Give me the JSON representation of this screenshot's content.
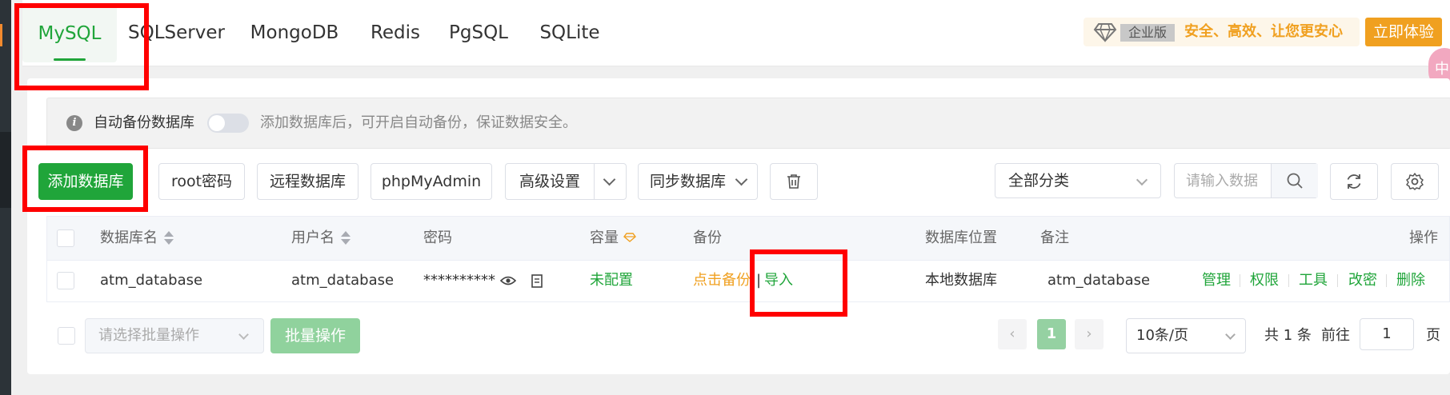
{
  "tabs": [
    {
      "label": "MySQL",
      "active": true
    },
    {
      "label": "SQLServer"
    },
    {
      "label": "MongoDB"
    },
    {
      "label": "Redis"
    },
    {
      "label": "PgSQL"
    },
    {
      "label": "SQLite"
    }
  ],
  "promo": {
    "badge": "企业版",
    "slogan": "安全、高效、让您更安心",
    "try_button": "立即体验",
    "float_char": "中"
  },
  "info": {
    "label": "自动备份数据库",
    "hint": "添加数据库后，可开启自动备份，保证数据安全。",
    "auto_backup_enabled": false
  },
  "toolbar": {
    "add_db": "添加数据库",
    "root_pwd": "root密码",
    "remote_db": "远程数据库",
    "phpmyadmin": "phpMyAdmin",
    "advanced": "高级设置",
    "sync_db": "同步数据库",
    "category": "全部分类",
    "search_placeholder": "请输入数据"
  },
  "table": {
    "headers": {
      "name": "数据库名",
      "user": "用户名",
      "password": "密码",
      "capacity": "容量",
      "backup": "备份",
      "location": "数据库位置",
      "remark": "备注",
      "ops": "操作"
    },
    "rows": [
      {
        "name": "atm_database",
        "user": "atm_database",
        "password": "**********",
        "capacity": "未配置",
        "backup": "点击备份",
        "backup_sep": "|",
        "import": "导入",
        "location": "本地数据库",
        "remark": "atm_database",
        "ops": [
          "管理",
          "权限",
          "工具",
          "改密",
          "删除"
        ]
      }
    ]
  },
  "footer": {
    "batch_placeholder": "请选择批量操作",
    "batch_button": "批量操作",
    "prev": "‹",
    "page": "1",
    "next": "›",
    "page_size": "10条/页",
    "total": "共 1 条",
    "goto": "前往",
    "goto_value": "1",
    "page_unit": "页"
  },
  "colors": {
    "accent": "#20a53a",
    "warning": "#f0a020",
    "highlight": "#ff0000"
  }
}
